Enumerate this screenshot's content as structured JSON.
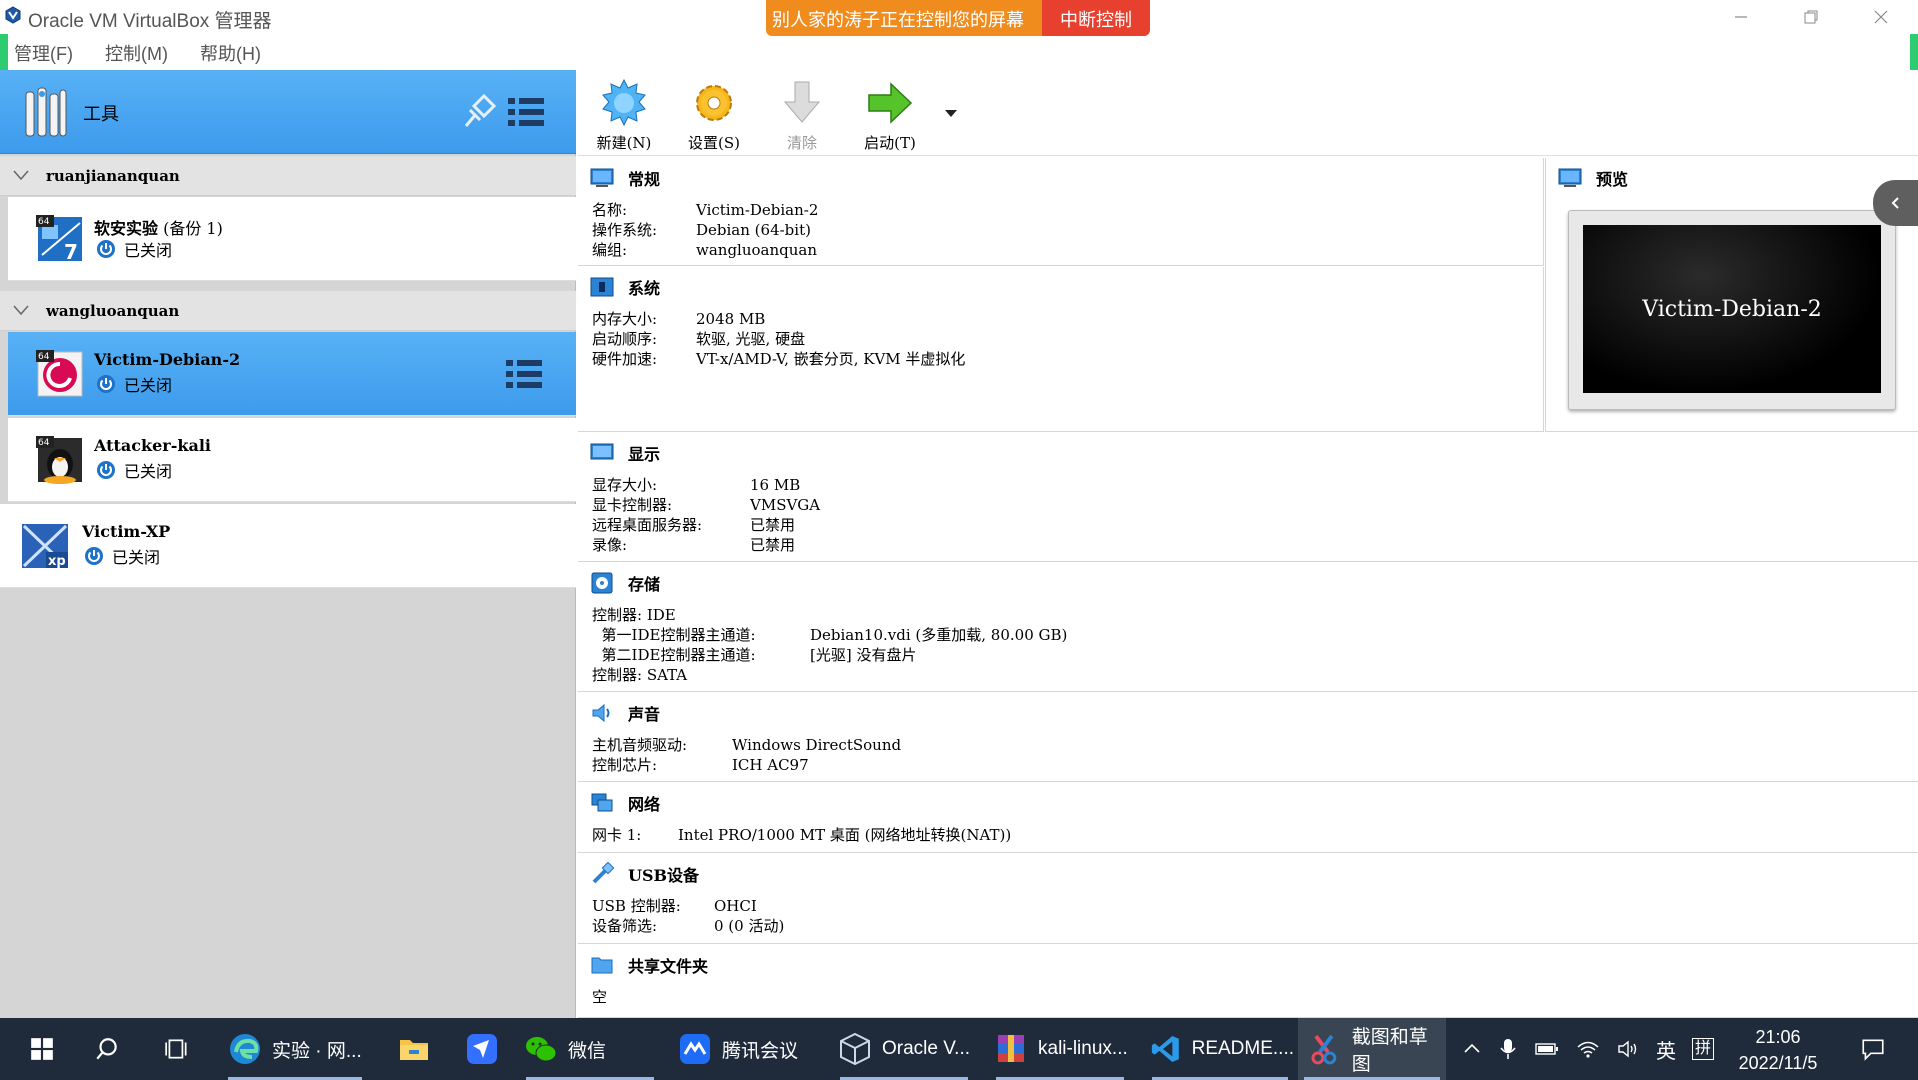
{
  "window": {
    "title": "Oracle VM VirtualBox 管理器"
  },
  "remote_banner": {
    "message": "别人家的涛子正在控制您的屏幕",
    "stop_label": "中断控制"
  },
  "menu": [
    "管理(F)",
    "控制(M)",
    "帮助(H)"
  ],
  "sidebar": {
    "tools_label": "工具",
    "groups": [
      {
        "name": "ruanjiananquan",
        "vms": [
          {
            "name": "软安实验",
            "suffix": " (备份 1)",
            "state": "已关闭",
            "os": "Windows 7 64"
          }
        ]
      },
      {
        "name": "wangluoanquan",
        "vms": [
          {
            "name": "Victim-Debian-2",
            "state": "已关闭",
            "os": "Debian 64"
          },
          {
            "name": "Attacker-kali",
            "state": "已关闭",
            "os": "Linux 64"
          }
        ]
      }
    ],
    "ungrouped": [
      {
        "name": "Victim-XP",
        "state": "已关闭",
        "os": "Windows XP"
      }
    ]
  },
  "toolbar": {
    "new": "新建(N)",
    "settings": "设置(S)",
    "discard": "清除",
    "start": "启动(T)"
  },
  "details": {
    "general": {
      "title": "常规",
      "rows": [
        [
          "名称:",
          "Victim-Debian-2"
        ],
        [
          "操作系统:",
          "Debian (64-bit)"
        ],
        [
          "编组:",
          "wangluoanquan"
        ]
      ]
    },
    "system": {
      "title": "系统",
      "rows": [
        [
          "内存大小:",
          "2048 MB"
        ],
        [
          "启动顺序:",
          "软驱, 光驱, 硬盘"
        ],
        [
          "硬件加速:",
          "VT-x/AMD-V, 嵌套分页, KVM 半虚拟化"
        ]
      ]
    },
    "display": {
      "title": "显示",
      "rows": [
        [
          "显存大小:",
          "16 MB"
        ],
        [
          "显卡控制器:",
          "VMSVGA"
        ],
        [
          "远程桌面服务器:",
          "已禁用"
        ],
        [
          "录像:",
          "已禁用"
        ]
      ]
    },
    "storage": {
      "title": "存储",
      "rows": [
        [
          "控制器: IDE",
          ""
        ],
        [
          "  第一IDE控制器主通道:",
          "Debian10.vdi (多重加载, 80.00 GB)"
        ],
        [
          "  第二IDE控制器主通道:",
          "[光驱] 没有盘片"
        ],
        [
          "控制器: SATA",
          ""
        ]
      ]
    },
    "audio": {
      "title": "声音",
      "rows": [
        [
          "主机音频驱动:",
          "Windows DirectSound"
        ],
        [
          "控制芯片:",
          "ICH AC97"
        ]
      ]
    },
    "network": {
      "title": "网络",
      "rows": [
        [
          "网卡 1:",
          "Intel PRO/1000 MT 桌面 (网络地址转换(NAT))"
        ]
      ]
    },
    "usb": {
      "title": "USB设备",
      "rows": [
        [
          "USB 控制器:",
          "OHCI"
        ],
        [
          "设备筛选:",
          "0 (0 活动)"
        ]
      ]
    },
    "shared": {
      "title": "共享文件夹",
      "rows": [
        [
          "空",
          ""
        ]
      ]
    }
  },
  "preview": {
    "title": "预览",
    "screen_text": "Victim-Debian-2"
  },
  "taskbar": {
    "items": [
      {
        "label": "实验 · 网...",
        "icon": "edge-icon"
      },
      {
        "label": "",
        "icon": "file-explorer-icon"
      },
      {
        "label": "",
        "icon": "feishu-icon"
      },
      {
        "label": "微信",
        "icon": "wechat-icon"
      },
      {
        "label": "腾讯会议",
        "icon": "tencent-meeting-icon"
      },
      {
        "label": "Oracle V...",
        "icon": "virtualbox-icon"
      },
      {
        "label": "kali-linux...",
        "icon": "winrar-icon"
      },
      {
        "label": "README....",
        "icon": "vscode-icon"
      },
      {
        "label": "截图和草图",
        "icon": "snip-sketch-icon"
      }
    ],
    "tray": {
      "ime": "英",
      "layout": "拼"
    },
    "clock": {
      "time": "21:06",
      "date": "2022/11/5"
    }
  },
  "colors": {
    "selection": "#3d9bed",
    "taskbar": "#1f2a3a",
    "banner_orange": "#f08c1e",
    "banner_red": "#e8402e"
  }
}
